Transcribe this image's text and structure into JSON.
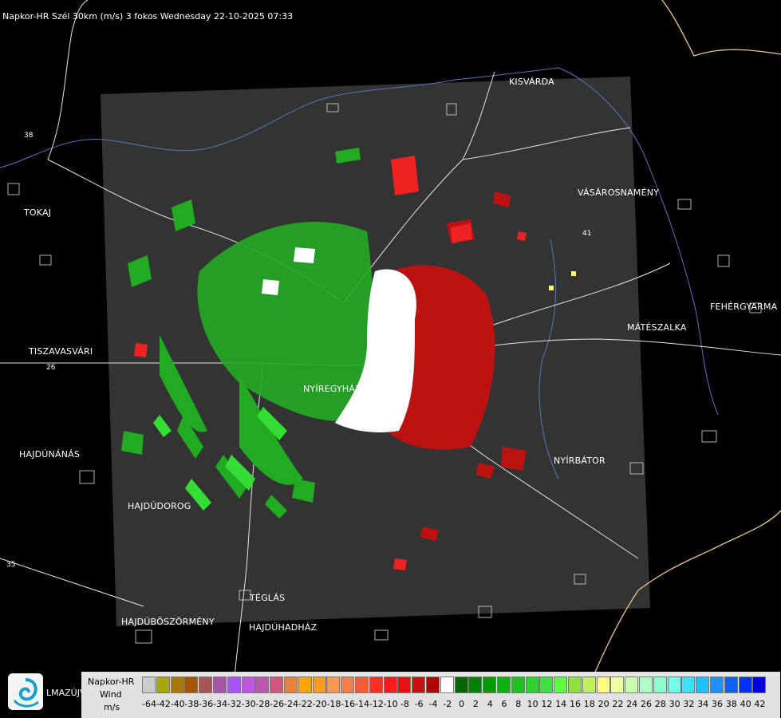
{
  "header": {
    "title": "Napkor-HR Szél 30km (m/s) 3 fokos Wednesday 22-10-2025 07:33"
  },
  "map": {
    "cities": [
      {
        "id": "kisvarda",
        "name": "KISVÁRDA"
      },
      {
        "id": "tokaj",
        "name": "TOKAJ"
      },
      {
        "id": "vasarosnameny",
        "name": "VÁSÁROSNAMÉNY"
      },
      {
        "id": "fehergyarmat",
        "name": "FEHÉRGYARMA"
      },
      {
        "id": "mateszalka",
        "name": "MÁTÉSZALKA"
      },
      {
        "id": "tiszavasvari",
        "name": "TISZAVASVÁRI"
      },
      {
        "id": "nyiregyhaza",
        "name": "NYÍREGYHÁZA"
      },
      {
        "id": "hajdunanas",
        "name": "HAJDÚNÁNÁS"
      },
      {
        "id": "nyirbator",
        "name": "NYÍRBÁTOR"
      },
      {
        "id": "hajdudorog",
        "name": "HAJDÚDOROG"
      },
      {
        "id": "teglas",
        "name": "TÉGLÁS"
      },
      {
        "id": "hajduboszormeny",
        "name": "HAJDÚBÖSZÖRMÉNY"
      },
      {
        "id": "hajduhadhaz",
        "name": "HAJDÚHADHÁZ"
      }
    ],
    "road_numbers": [
      "38",
      "26",
      "35",
      "41"
    ]
  },
  "logo": {
    "text": "LMAZÚJVÁR"
  },
  "legend": {
    "title_lines": [
      "Napkor-HR",
      "Wind",
      "m/s"
    ],
    "colors": [
      "#cccccc",
      "#a7a705",
      "#a77a05",
      "#a75505",
      "#a75555",
      "#a755a7",
      "#a755ff",
      "#c055e0",
      "#c055b0",
      "#d05580",
      "#e88040",
      "#ffa500",
      "#ff9a22",
      "#f59a50",
      "#f08050",
      "#ff5a30",
      "#ff3020",
      "#ff1a1a",
      "#e51010",
      "#cc1010",
      "#b20000",
      "#ffffff",
      "#006600",
      "#008000",
      "#009a00",
      "#10b010",
      "#20c020",
      "#30d030",
      "#40e040",
      "#60ff40",
      "#90e040",
      "#c0f060",
      "#ffff80",
      "#f0ffa0",
      "#c8ffb0",
      "#b0ffc8",
      "#90ffd0",
      "#70ffe8",
      "#40e0ff",
      "#20c0ff",
      "#2090ff",
      "#1060ff",
      "#0030ff",
      "#0000dd"
    ],
    "ticks": [
      "-64",
      "-42",
      "-40",
      "-38",
      "-36",
      "-34",
      "-32",
      "-30",
      "-28",
      "-26",
      "-24",
      "-22",
      "-20",
      "-18",
      "-16",
      "-14",
      "-12",
      "-10",
      "-8",
      "-6",
      "-4",
      "-2",
      "0",
      "2",
      "4",
      "6",
      "8",
      "10",
      "12",
      "14",
      "16",
      "18",
      "20",
      "22",
      "24",
      "26",
      "28",
      "30",
      "32",
      "34",
      "36",
      "38",
      "40",
      "42"
    ]
  }
}
